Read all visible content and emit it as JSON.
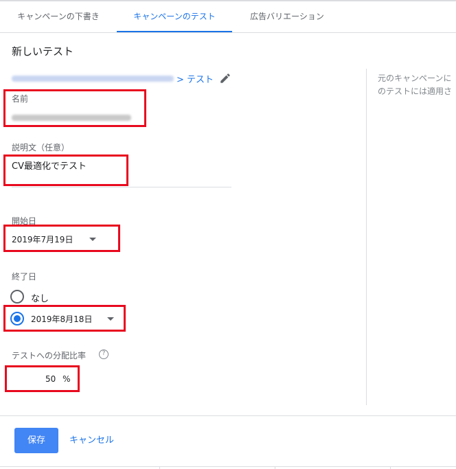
{
  "tabs": [
    {
      "label": "キャンペーンの下書き"
    },
    {
      "label": "キャンペーンのテスト"
    },
    {
      "label": "広告バリエーション"
    }
  ],
  "panel": {
    "title": "新しいテスト",
    "breadcrumb_link": "> テスト",
    "side_text_line1": "元のキャンペーンに",
    "side_text_line2": "のテストには適用さ"
  },
  "form": {
    "name_label": "名前",
    "description_label": "説明文（任意）",
    "description_value": "CV最適化でテスト",
    "start_date_label": "開始日",
    "start_date_value": "2019年7月19日",
    "end_date_label": "終了日",
    "end_none_label": "なし",
    "end_date_value": "2019年8月18日",
    "split_label": "テストへの分配比率",
    "split_value": "50",
    "split_unit": "%"
  },
  "actions": {
    "save_label": "保存",
    "cancel_label": "キャンセル"
  },
  "colors": {
    "accent": "#1a73e8",
    "primary_button": "#4285f4",
    "highlight_box": "#e8091e"
  },
  "icons": {
    "edit": "pencil-icon",
    "help": "help-circle-icon",
    "dropdown": "caret-down-icon"
  }
}
